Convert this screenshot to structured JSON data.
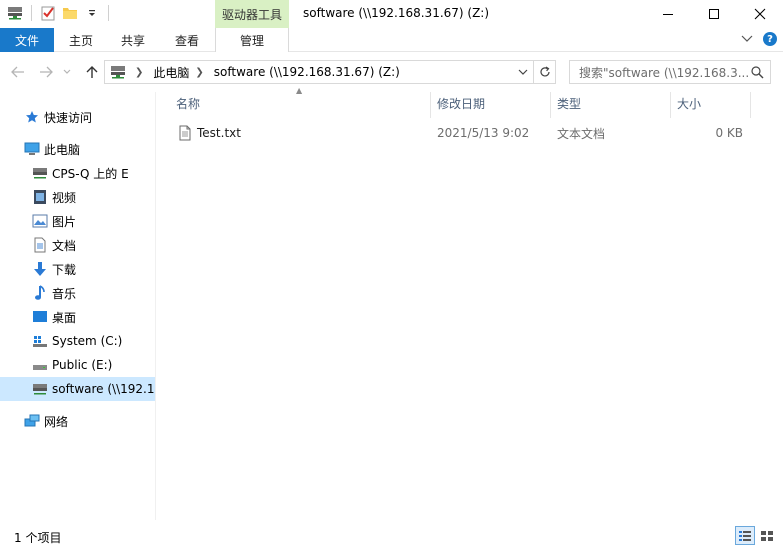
{
  "window": {
    "title": "software (\\\\192.168.31.67) (Z:)",
    "context_tool": "驱动器工具"
  },
  "ribbon": {
    "tabs": {
      "file": "文件",
      "home": "主页",
      "share": "共享",
      "view": "查看",
      "manage": "管理"
    },
    "help": "?"
  },
  "address": {
    "crumbs": [
      "此电脑",
      "software (\\\\192.168.31.67) (Z:)"
    ]
  },
  "search": {
    "placeholder": "搜索\"software (\\\\192.168.3..."
  },
  "nav": {
    "quick_access": "快速访问",
    "this_pc": "此电脑",
    "cps_q": "CPS-Q 上的 E",
    "videos": "视频",
    "pictures": "图片",
    "documents": "文档",
    "downloads": "下载",
    "music": "音乐",
    "desktop": "桌面",
    "system_c": "System (C:)",
    "public_e": "Public (E:)",
    "software_z": "software (\\\\192.16",
    "network": "网络"
  },
  "columns": {
    "name": "名称",
    "date": "修改日期",
    "type": "类型",
    "size": "大小"
  },
  "files": [
    {
      "name": "Test.txt",
      "date": "2021/5/13 9:02",
      "type": "文本文档",
      "size": "0 KB"
    }
  ],
  "status": {
    "count": "1 个项目"
  },
  "colors": {
    "accent": "#1979ca",
    "context_tab": "#d9f0c4",
    "selection": "#cce8ff"
  }
}
